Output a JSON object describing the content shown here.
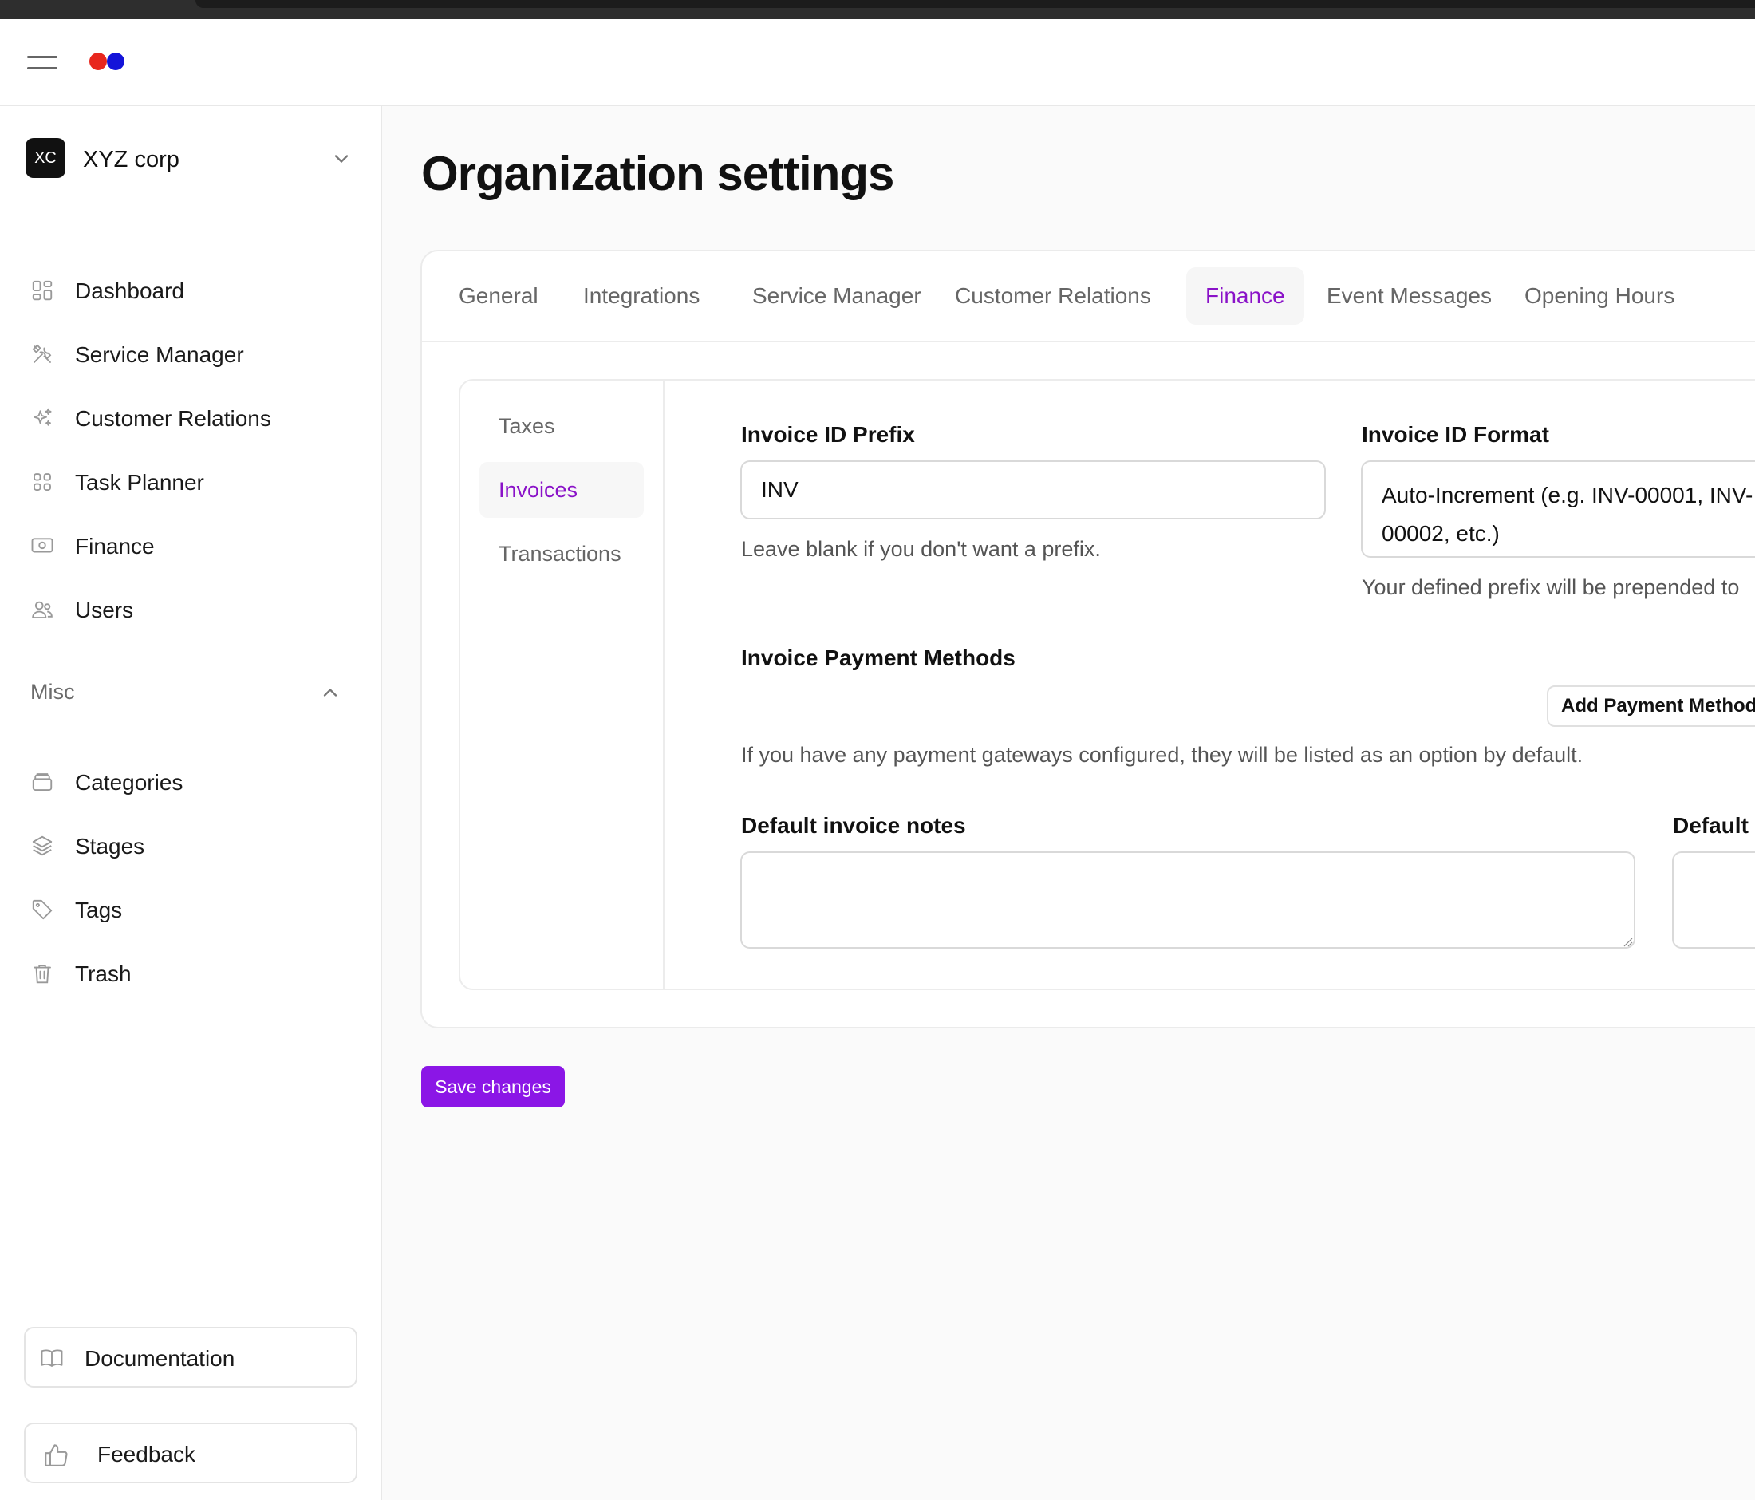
{
  "colors": {
    "accent": "#8a12c8",
    "primary_button": "#8b16e6",
    "logo_red": "#e8271e",
    "logo_blue": "#1414d9"
  },
  "org": {
    "initials": "XC",
    "name": "XYZ corp"
  },
  "sidebar": {
    "items": [
      {
        "label": "Dashboard",
        "icon": "dashboard-icon"
      },
      {
        "label": "Service Manager",
        "icon": "tools-icon"
      },
      {
        "label": "Customer Relations",
        "icon": "sparkles-icon"
      },
      {
        "label": "Task Planner",
        "icon": "grid-icon"
      },
      {
        "label": "Finance",
        "icon": "banknote-icon"
      },
      {
        "label": "Users",
        "icon": "users-icon"
      }
    ],
    "misc_label": "Misc",
    "misc_items": [
      {
        "label": "Categories",
        "icon": "archive-icon"
      },
      {
        "label": "Stages",
        "icon": "layers-icon"
      },
      {
        "label": "Tags",
        "icon": "tag-icon"
      },
      {
        "label": "Trash",
        "icon": "trash-icon"
      }
    ],
    "documentation": "Documentation",
    "feedback": "Feedback"
  },
  "page": {
    "title": "Organization settings"
  },
  "tabs": [
    "General",
    "Integrations",
    "Service Manager",
    "Customer Relations",
    "Finance",
    "Event Messages",
    "Opening Hours"
  ],
  "active_tab": "Finance",
  "subnav": [
    "Taxes",
    "Invoices",
    "Transactions"
  ],
  "active_subnav": "Invoices",
  "invoice": {
    "prefix_label": "Invoice ID Prefix",
    "prefix_value": "INV",
    "prefix_help": "Leave blank if you don't want a prefix.",
    "format_label": "Invoice ID Format",
    "format_value": "Auto-Increment (e.g. INV-00001, INV-00002, etc.)",
    "format_help": "Your defined prefix will be prepended to",
    "payment_methods_label": "Invoice Payment Methods",
    "add_payment_method": "Add Payment Method",
    "payment_help": "If you have any payment gateways configured, they will be listed as an option by default.",
    "notes_label": "Default invoice notes",
    "notes_value": "",
    "second_notes_label": "Default i"
  },
  "save_button": "Save changes"
}
